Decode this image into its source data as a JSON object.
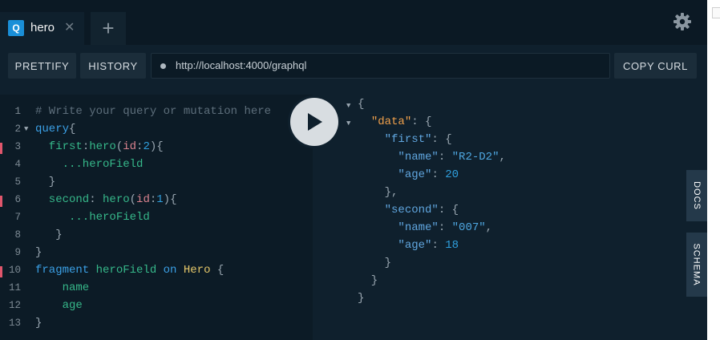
{
  "tabs": [
    {
      "icon": "Q",
      "title": "hero",
      "close": "✕"
    }
  ],
  "add_tab": "+",
  "toolbar": {
    "prettify": "PRETTIFY",
    "history": "HISTORY",
    "url": "http://localhost:4000/graphql",
    "copy_curl": "COPY CURL"
  },
  "editor": {
    "line_numbers": [
      "1",
      "2",
      "3",
      "4",
      "5",
      "6",
      "7",
      "8",
      "9",
      "10",
      "11",
      "12",
      "13"
    ],
    "lines": [
      [
        {
          "t": "# Write your query or mutation here",
          "c": "c-comment"
        }
      ],
      [
        {
          "t": "query",
          "c": "c-kw"
        },
        {
          "t": "{",
          "c": "c-punc"
        }
      ],
      [
        {
          "t": "  first",
          "c": "c-field"
        },
        {
          "t": ":",
          "c": "c-punc"
        },
        {
          "t": "hero",
          "c": "c-field"
        },
        {
          "t": "(",
          "c": "c-punc"
        },
        {
          "t": "id",
          "c": "c-arg"
        },
        {
          "t": ":",
          "c": "c-punc"
        },
        {
          "t": "2",
          "c": "c-num"
        },
        {
          "t": "){",
          "c": "c-punc"
        }
      ],
      [
        {
          "t": "    ...heroField",
          "c": "c-field"
        }
      ],
      [
        {
          "t": "  }",
          "c": "c-punc"
        }
      ],
      [
        {
          "t": "  second",
          "c": "c-field"
        },
        {
          "t": ": ",
          "c": "c-punc"
        },
        {
          "t": "hero",
          "c": "c-field"
        },
        {
          "t": "(",
          "c": "c-punc"
        },
        {
          "t": "id",
          "c": "c-arg"
        },
        {
          "t": ":",
          "c": "c-punc"
        },
        {
          "t": "1",
          "c": "c-num"
        },
        {
          "t": "){",
          "c": "c-punc"
        }
      ],
      [
        {
          "t": "     ...heroField",
          "c": "c-field"
        }
      ],
      [
        {
          "t": "   }",
          "c": "c-punc"
        }
      ],
      [
        {
          "t": "}",
          "c": "c-punc"
        }
      ],
      [
        {
          "t": "fragment ",
          "c": "c-kw"
        },
        {
          "t": "heroField",
          "c": "c-field"
        },
        {
          "t": " on ",
          "c": "c-kw"
        },
        {
          "t": "Hero",
          "c": "c-type"
        },
        {
          "t": " {",
          "c": "c-punc"
        }
      ],
      [
        {
          "t": "    name",
          "c": "c-field"
        }
      ],
      [
        {
          "t": "    age",
          "c": "c-field"
        }
      ],
      [
        {
          "t": "}",
          "c": "c-punc"
        }
      ]
    ],
    "error_marker_lines": [
      3,
      6,
      10
    ]
  },
  "result": {
    "lines": [
      [
        {
          "t": "{",
          "c": "r-punc"
        }
      ],
      [
        {
          "t": "  ",
          "c": "r-punc"
        },
        {
          "t": "\"data\"",
          "c": "r-data"
        },
        {
          "t": ": {",
          "c": "r-punc"
        }
      ],
      [
        {
          "t": "    ",
          "c": "r-punc"
        },
        {
          "t": "\"first\"",
          "c": "r-key"
        },
        {
          "t": ": {",
          "c": "r-punc"
        }
      ],
      [
        {
          "t": "      ",
          "c": "r-punc"
        },
        {
          "t": "\"name\"",
          "c": "r-key"
        },
        {
          "t": ": ",
          "c": "r-punc"
        },
        {
          "t": "\"R2-D2\"",
          "c": "r-str"
        },
        {
          "t": ",",
          "c": "r-punc"
        }
      ],
      [
        {
          "t": "      ",
          "c": "r-punc"
        },
        {
          "t": "\"age\"",
          "c": "r-key"
        },
        {
          "t": ": ",
          "c": "r-punc"
        },
        {
          "t": "20",
          "c": "r-num"
        }
      ],
      [
        {
          "t": "    },",
          "c": "r-punc"
        }
      ],
      [
        {
          "t": "    ",
          "c": "r-punc"
        },
        {
          "t": "\"second\"",
          "c": "r-key"
        },
        {
          "t": ": {",
          "c": "r-punc"
        }
      ],
      [
        {
          "t": "      ",
          "c": "r-punc"
        },
        {
          "t": "\"name\"",
          "c": "r-key"
        },
        {
          "t": ": ",
          "c": "r-punc"
        },
        {
          "t": "\"007\"",
          "c": "r-str"
        },
        {
          "t": ",",
          "c": "r-punc"
        }
      ],
      [
        {
          "t": "      ",
          "c": "r-punc"
        },
        {
          "t": "\"age\"",
          "c": "r-key"
        },
        {
          "t": ": ",
          "c": "r-punc"
        },
        {
          "t": "18",
          "c": "r-num"
        }
      ],
      [
        {
          "t": "    }",
          "c": "r-punc"
        }
      ],
      [
        {
          "t": "  }",
          "c": "r-punc"
        }
      ],
      [
        {
          "t": "}",
          "c": "r-punc"
        }
      ]
    ]
  },
  "side_tabs": {
    "docs": "DOCS",
    "schema": "SCHEMA"
  },
  "icons": {
    "settings": "gear-icon",
    "run": "play-icon",
    "tab_close": "close-icon",
    "add_tab": "plus-icon",
    "fold": "fold-arrow-icon"
  },
  "colors": {
    "background": "#0f202d",
    "editor": "#0c1b26",
    "accent": "#1a8fd8",
    "error_marker": "#e0566c"
  }
}
